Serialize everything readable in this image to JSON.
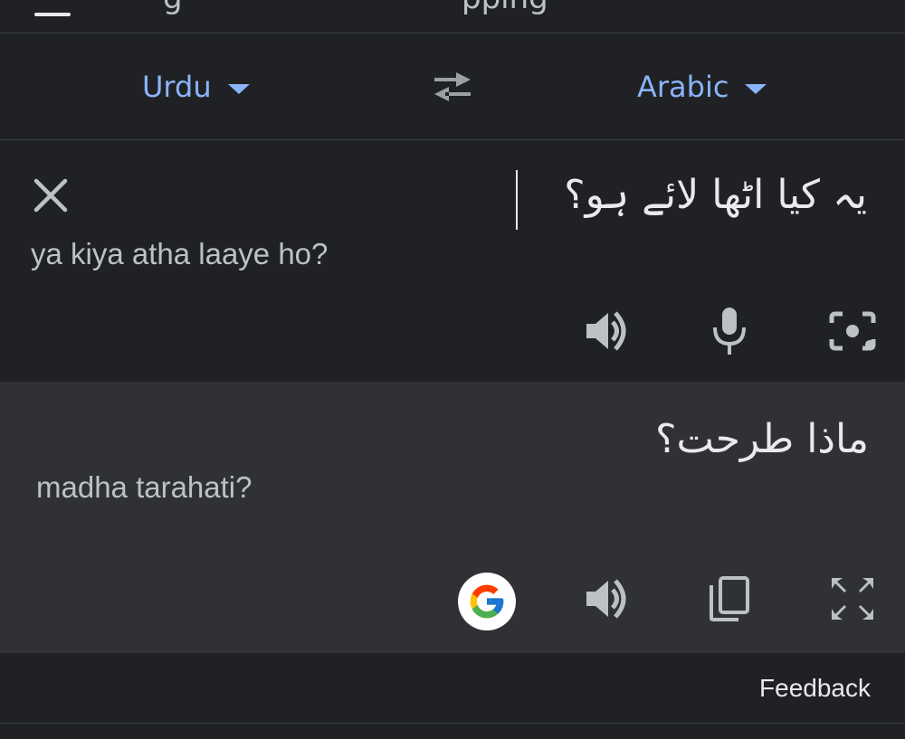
{
  "header": {
    "tab_hint_left": "g",
    "tab_hint_right": "pping"
  },
  "languages": {
    "source": "Urdu",
    "target": "Arabic"
  },
  "input": {
    "text": "یہ کیا اٹھا لائے ہو؟",
    "transliteration": "ya kiya atha laaye ho?"
  },
  "output": {
    "text": "ماذا طرحت؟",
    "transliteration": "madha tarahati?"
  },
  "icons": {
    "clear": "close-icon",
    "swap": "swap-icon",
    "speak": "volume-icon",
    "mic": "microphone-icon",
    "camera": "camera-icon",
    "google": "google-icon",
    "copy": "copy-icon",
    "fullscreen": "fullscreen-icon"
  },
  "colors": {
    "accent": "#8ab4f8",
    "background": "#202124",
    "output_background": "#303134",
    "icon": "#bdc1c6"
  },
  "footer": {
    "feedback_label": "Feedback"
  }
}
